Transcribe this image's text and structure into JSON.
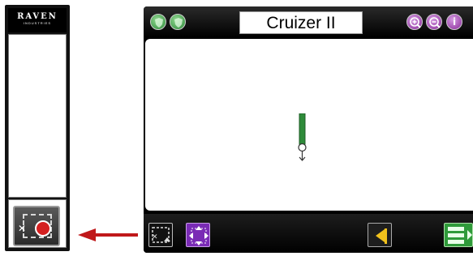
{
  "logo": {
    "main": "RAVEN",
    "sub": "INDUSTRIES"
  },
  "header": {
    "title": "Cruizer II"
  },
  "icons": {
    "left": [
      "shield-icon",
      "shield-icon"
    ],
    "right": [
      "zoom-in-icon",
      "zoom-out-icon",
      "info-icon"
    ],
    "info_glyph": "i"
  },
  "toolbar": {
    "buttons": [
      "select-area-button",
      "pan-button",
      "flag-button",
      "layers-button"
    ]
  },
  "colors": {
    "accent_purple": "#7a2bb5",
    "accent_green": "#2f9a3a",
    "record_red": "#d42020",
    "arrow_red": "#c0181a",
    "flag_yellow": "#f2c21c"
  }
}
